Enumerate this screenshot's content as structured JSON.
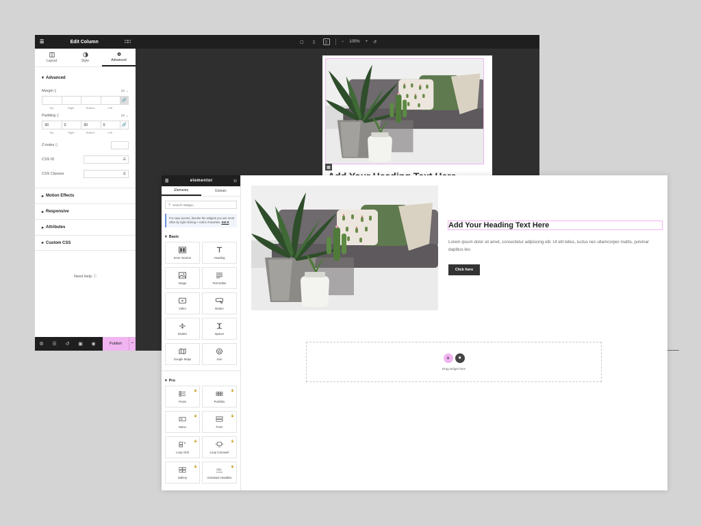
{
  "back_window": {
    "panel_title": "Edit Column",
    "tabs": [
      {
        "label": "Layout",
        "icon": "layout-icon"
      },
      {
        "label": "Style",
        "icon": "style-icon"
      },
      {
        "label": "Advanced",
        "icon": "gear-icon"
      }
    ],
    "section_title": "Advanced",
    "margin": {
      "label": "Margin",
      "unit": "px",
      "values": [
        "",
        "",
        "",
        ""
      ]
    },
    "dim_labels": [
      "Top",
      "Right",
      "Bottom",
      "Left"
    ],
    "padding": {
      "label": "Padding",
      "unit": "px",
      "values": [
        "30",
        "0",
        "30",
        "0"
      ]
    },
    "z_index": {
      "label": "Z-index",
      "value": ""
    },
    "css_id": {
      "label": "CSS ID",
      "value": ""
    },
    "css_classes": {
      "label": "CSS Classes",
      "value": ""
    },
    "collapsibles": [
      "Motion Effects",
      "Responsive",
      "Attributes",
      "Custom CSS"
    ],
    "need_help": "Need Help",
    "publish_label": "Publish",
    "zoom": "100%",
    "canvas_heading": "Add Your Heading Text Here"
  },
  "front_window": {
    "brand": "elementor",
    "tabs": [
      "Elements",
      "Globals"
    ],
    "search_placeholder": "Search Widget...",
    "tip_text": "For easy access, favorite the widgets you use most often by right clicking > Add to Favorites.",
    "tip_link": "Got It",
    "basic_title": "Basic",
    "basic_widgets": [
      {
        "label": "Inner Section",
        "icon": "inner-section-icon"
      },
      {
        "label": "Heading",
        "icon": "heading-icon"
      },
      {
        "label": "Image",
        "icon": "image-icon"
      },
      {
        "label": "Text Editor",
        "icon": "text-editor-icon"
      },
      {
        "label": "Video",
        "icon": "video-icon"
      },
      {
        "label": "Button",
        "icon": "button-icon"
      },
      {
        "label": "Divider",
        "icon": "divider-icon"
      },
      {
        "label": "Spacer",
        "icon": "spacer-icon"
      },
      {
        "label": "Google Maps",
        "icon": "google-maps-icon"
      },
      {
        "label": "Icon",
        "icon": "star-icon"
      }
    ],
    "pro_title": "Pro",
    "pro_widgets": [
      {
        "label": "Posts",
        "icon": "posts-icon"
      },
      {
        "label": "Portfolio",
        "icon": "portfolio-icon"
      },
      {
        "label": "Menu",
        "icon": "menu-icon"
      },
      {
        "label": "Form",
        "icon": "form-icon"
      },
      {
        "label": "Loop Grid",
        "icon": "loop-grid-icon"
      },
      {
        "label": "Loop Carousel",
        "icon": "loop-carousel-icon"
      },
      {
        "label": "Gallery",
        "icon": "gallery-icon"
      },
      {
        "label": "Animated Headline",
        "icon": "animated-headline-icon"
      }
    ],
    "heading": "Add Your Heading Text Here",
    "body_text": "Lorem ipsum dolor sit amet, consectetur adipiscing elit. Ut elit tellus, luctus nec ullamcorper mattis, pulvinar dapibus leo.",
    "button_label": "Click here",
    "drop_label": "Drag widget here"
  },
  "colors": {
    "accent_pink": "#f0b4f0",
    "dark_bar": "#1f1f1f",
    "editor_canvas": "#2f2f2f"
  }
}
